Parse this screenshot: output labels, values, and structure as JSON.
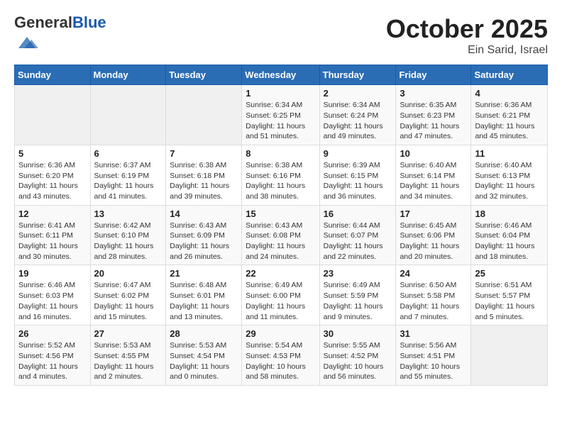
{
  "header": {
    "logo_general": "General",
    "logo_blue": "Blue",
    "month": "October 2025",
    "location": "Ein Sarid, Israel"
  },
  "weekdays": [
    "Sunday",
    "Monday",
    "Tuesday",
    "Wednesday",
    "Thursday",
    "Friday",
    "Saturday"
  ],
  "weeks": [
    [
      {
        "day": "",
        "content": ""
      },
      {
        "day": "",
        "content": ""
      },
      {
        "day": "",
        "content": ""
      },
      {
        "day": "1",
        "content": "Sunrise: 6:34 AM\nSunset: 6:25 PM\nDaylight: 11 hours\nand 51 minutes."
      },
      {
        "day": "2",
        "content": "Sunrise: 6:34 AM\nSunset: 6:24 PM\nDaylight: 11 hours\nand 49 minutes."
      },
      {
        "day": "3",
        "content": "Sunrise: 6:35 AM\nSunset: 6:23 PM\nDaylight: 11 hours\nand 47 minutes."
      },
      {
        "day": "4",
        "content": "Sunrise: 6:36 AM\nSunset: 6:21 PM\nDaylight: 11 hours\nand 45 minutes."
      }
    ],
    [
      {
        "day": "5",
        "content": "Sunrise: 6:36 AM\nSunset: 6:20 PM\nDaylight: 11 hours\nand 43 minutes."
      },
      {
        "day": "6",
        "content": "Sunrise: 6:37 AM\nSunset: 6:19 PM\nDaylight: 11 hours\nand 41 minutes."
      },
      {
        "day": "7",
        "content": "Sunrise: 6:38 AM\nSunset: 6:18 PM\nDaylight: 11 hours\nand 39 minutes."
      },
      {
        "day": "8",
        "content": "Sunrise: 6:38 AM\nSunset: 6:16 PM\nDaylight: 11 hours\nand 38 minutes."
      },
      {
        "day": "9",
        "content": "Sunrise: 6:39 AM\nSunset: 6:15 PM\nDaylight: 11 hours\nand 36 minutes."
      },
      {
        "day": "10",
        "content": "Sunrise: 6:40 AM\nSunset: 6:14 PM\nDaylight: 11 hours\nand 34 minutes."
      },
      {
        "day": "11",
        "content": "Sunrise: 6:40 AM\nSunset: 6:13 PM\nDaylight: 11 hours\nand 32 minutes."
      }
    ],
    [
      {
        "day": "12",
        "content": "Sunrise: 6:41 AM\nSunset: 6:11 PM\nDaylight: 11 hours\nand 30 minutes."
      },
      {
        "day": "13",
        "content": "Sunrise: 6:42 AM\nSunset: 6:10 PM\nDaylight: 11 hours\nand 28 minutes."
      },
      {
        "day": "14",
        "content": "Sunrise: 6:43 AM\nSunset: 6:09 PM\nDaylight: 11 hours\nand 26 minutes."
      },
      {
        "day": "15",
        "content": "Sunrise: 6:43 AM\nSunset: 6:08 PM\nDaylight: 11 hours\nand 24 minutes."
      },
      {
        "day": "16",
        "content": "Sunrise: 6:44 AM\nSunset: 6:07 PM\nDaylight: 11 hours\nand 22 minutes."
      },
      {
        "day": "17",
        "content": "Sunrise: 6:45 AM\nSunset: 6:06 PM\nDaylight: 11 hours\nand 20 minutes."
      },
      {
        "day": "18",
        "content": "Sunrise: 6:46 AM\nSunset: 6:04 PM\nDaylight: 11 hours\nand 18 minutes."
      }
    ],
    [
      {
        "day": "19",
        "content": "Sunrise: 6:46 AM\nSunset: 6:03 PM\nDaylight: 11 hours\nand 16 minutes."
      },
      {
        "day": "20",
        "content": "Sunrise: 6:47 AM\nSunset: 6:02 PM\nDaylight: 11 hours\nand 15 minutes."
      },
      {
        "day": "21",
        "content": "Sunrise: 6:48 AM\nSunset: 6:01 PM\nDaylight: 11 hours\nand 13 minutes."
      },
      {
        "day": "22",
        "content": "Sunrise: 6:49 AM\nSunset: 6:00 PM\nDaylight: 11 hours\nand 11 minutes."
      },
      {
        "day": "23",
        "content": "Sunrise: 6:49 AM\nSunset: 5:59 PM\nDaylight: 11 hours\nand 9 minutes."
      },
      {
        "day": "24",
        "content": "Sunrise: 6:50 AM\nSunset: 5:58 PM\nDaylight: 11 hours\nand 7 minutes."
      },
      {
        "day": "25",
        "content": "Sunrise: 6:51 AM\nSunset: 5:57 PM\nDaylight: 11 hours\nand 5 minutes."
      }
    ],
    [
      {
        "day": "26",
        "content": "Sunrise: 5:52 AM\nSunset: 4:56 PM\nDaylight: 11 hours\nand 4 minutes."
      },
      {
        "day": "27",
        "content": "Sunrise: 5:53 AM\nSunset: 4:55 PM\nDaylight: 11 hours\nand 2 minutes."
      },
      {
        "day": "28",
        "content": "Sunrise: 5:53 AM\nSunset: 4:54 PM\nDaylight: 11 hours\nand 0 minutes."
      },
      {
        "day": "29",
        "content": "Sunrise: 5:54 AM\nSunset: 4:53 PM\nDaylight: 10 hours\nand 58 minutes."
      },
      {
        "day": "30",
        "content": "Sunrise: 5:55 AM\nSunset: 4:52 PM\nDaylight: 10 hours\nand 56 minutes."
      },
      {
        "day": "31",
        "content": "Sunrise: 5:56 AM\nSunset: 4:51 PM\nDaylight: 10 hours\nand 55 minutes."
      },
      {
        "day": "",
        "content": ""
      }
    ]
  ]
}
